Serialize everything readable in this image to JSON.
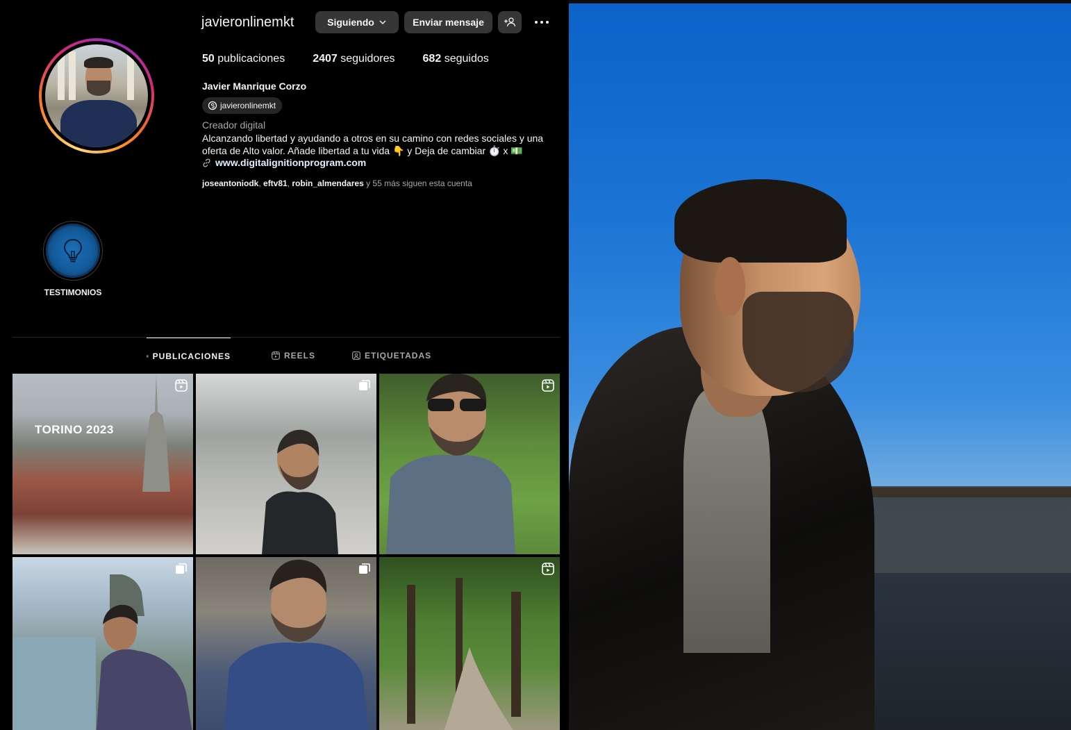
{
  "profile": {
    "username": "javieronlinemkt",
    "following_button": "Siguiendo",
    "message_button": "Enviar mensaje",
    "stats": {
      "posts_count": "50",
      "posts_label": "publicaciones",
      "followers_count": "2407",
      "followers_label": "seguidores",
      "following_count": "682",
      "following_label": "seguidos"
    },
    "full_name": "Javier Manrique Corzo",
    "threads_handle": "javieronlinemkt",
    "category": "Creador digital",
    "bio": "Alcanzando libertad y ayudando a otros en su camino con redes sociales y una oferta de Alto valor. Añade libertad a tu vida 👇 y Deja de cambiar ⏱️ x 💵",
    "link": "www.digitalignitionprogram.com",
    "followed_by": {
      "users": [
        "joseantoniodk",
        "eftv81",
        "robin_almendares"
      ],
      "suffix": "y 55 más siguen esta cuenta"
    }
  },
  "highlights": [
    {
      "label": "TESTIMONIOS",
      "icon": "lightbulb-icon"
    }
  ],
  "tabs": [
    {
      "label": "PUBLICACIONES",
      "icon": "grid-icon",
      "active": true
    },
    {
      "label": "REELS",
      "icon": "reels-icon",
      "active": false
    },
    {
      "label": "ETIQUETADAS",
      "icon": "tagged-icon",
      "active": false
    }
  ],
  "posts": [
    {
      "caption": "TORINO 2023",
      "badge": "reel-icon"
    },
    {
      "caption": "",
      "badge": "carousel-icon"
    },
    {
      "caption": "",
      "badge": "reel-icon"
    },
    {
      "caption": "",
      "badge": "carousel-icon"
    },
    {
      "caption": "",
      "badge": "carousel-icon"
    },
    {
      "caption": "",
      "badge": "reel-icon"
    }
  ],
  "colors": {
    "background": "#000000",
    "button": "#363636",
    "secondary_text": "#a8a8a8",
    "link": "#e0f1ff"
  }
}
